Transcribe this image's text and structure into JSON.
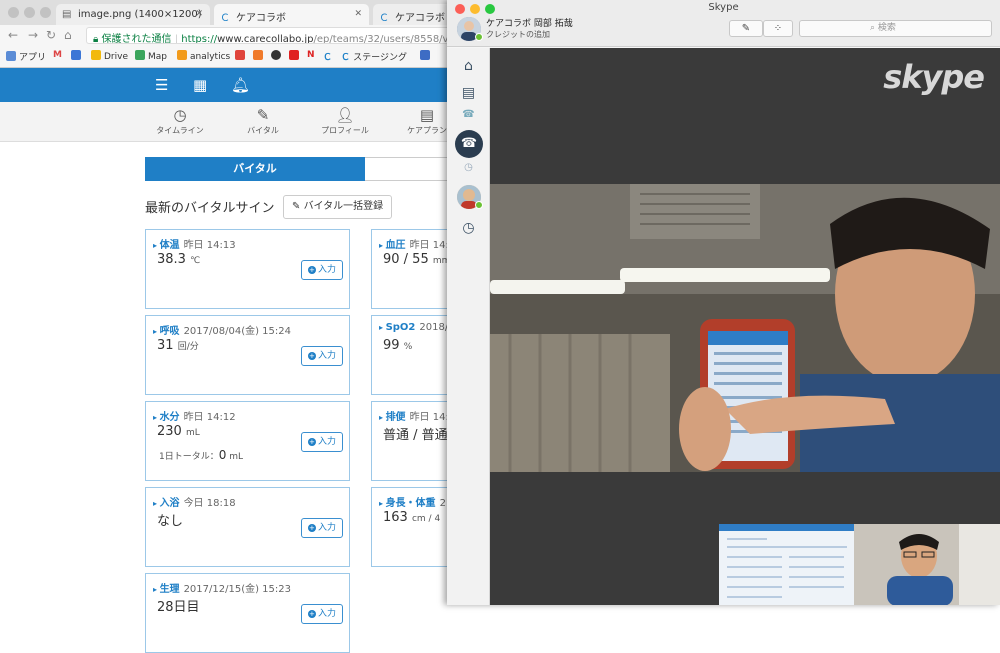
{
  "browser": {
    "tabs": [
      {
        "title": "image.png (1400×1200)"
      },
      {
        "title": "ケアコラボ"
      },
      {
        "title": "ケアコラボ"
      }
    ],
    "address": {
      "secure_label": "保護された通信",
      "scheme": "https://",
      "domain": "www.carecollabo.jp",
      "path": "/ep/teams/32/users/8558/vitalsig"
    },
    "bookmarks": [
      "アプリ",
      "Drive",
      "Map",
      "analytics",
      "ステージング"
    ]
  },
  "app": {
    "subnav": [
      {
        "label": "タイムライン",
        "icon": "clock-icon"
      },
      {
        "label": "バイタル",
        "icon": "pen-icon"
      },
      {
        "label": "プロフィール",
        "icon": "person-icon"
      },
      {
        "label": "ケアプラン",
        "icon": "document-icon"
      }
    ],
    "vital_tab": "バイタル",
    "section_title": "最新のバイタルサイン",
    "bulk_button": "バイタル一括登録",
    "input_label": "入力",
    "cards_left": [
      {
        "name": "体温",
        "time": "昨日 14:13",
        "value": "38.3",
        "unit": "℃"
      },
      {
        "name": "呼吸",
        "time": "2017/08/04(金) 15:24",
        "value": "31",
        "unit": "回/分"
      },
      {
        "name": "水分",
        "time": "昨日 14:12",
        "value": "230",
        "unit": "mL",
        "sub_label": "1日トータル：",
        "sub_value": "0",
        "sub_unit": "mL"
      },
      {
        "name": "入浴",
        "time": "今日 18:18",
        "value": "なし",
        "unit": ""
      },
      {
        "name": "生理",
        "time": "2017/12/15(金) 15:23",
        "value": "28日目",
        "unit": ""
      }
    ],
    "cards_right": [
      {
        "name": "血圧",
        "time": "昨日 14:1",
        "value": "90 / 55",
        "unit": "mm"
      },
      {
        "name": "SpO2",
        "time": "2018/0",
        "value": "99",
        "unit": "%"
      },
      {
        "name": "排便",
        "time": "昨日 14:1",
        "value": "普通 / 普通",
        "unit": ""
      },
      {
        "name": "身長・体重",
        "time": "2",
        "value": "163",
        "unit": "cm / 4"
      }
    ]
  },
  "skype": {
    "window_title": "Skype",
    "user_name": "ケアコラボ 岡部 拓哉",
    "credit_link": "クレジットの追加",
    "search_placeholder": "検索",
    "logo_text": "skype"
  },
  "colors": {
    "brand_blue": "#1f7fc6",
    "skype_blue": "#00aff0"
  }
}
